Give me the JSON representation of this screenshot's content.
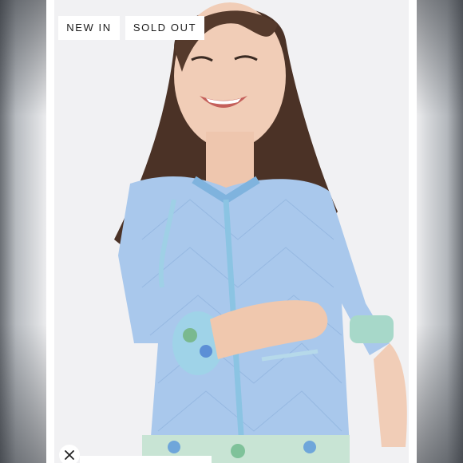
{
  "badges": {
    "new_in": "NEW IN",
    "sold_out": "SOLD OUT"
  },
  "icons": {
    "close": "close-icon"
  },
  "colors": {
    "badge_bg": "#ffffff",
    "badge_text": "#1b1b1b",
    "jacket_blue": "#a9c8ec",
    "background": "#f1f1f3"
  }
}
